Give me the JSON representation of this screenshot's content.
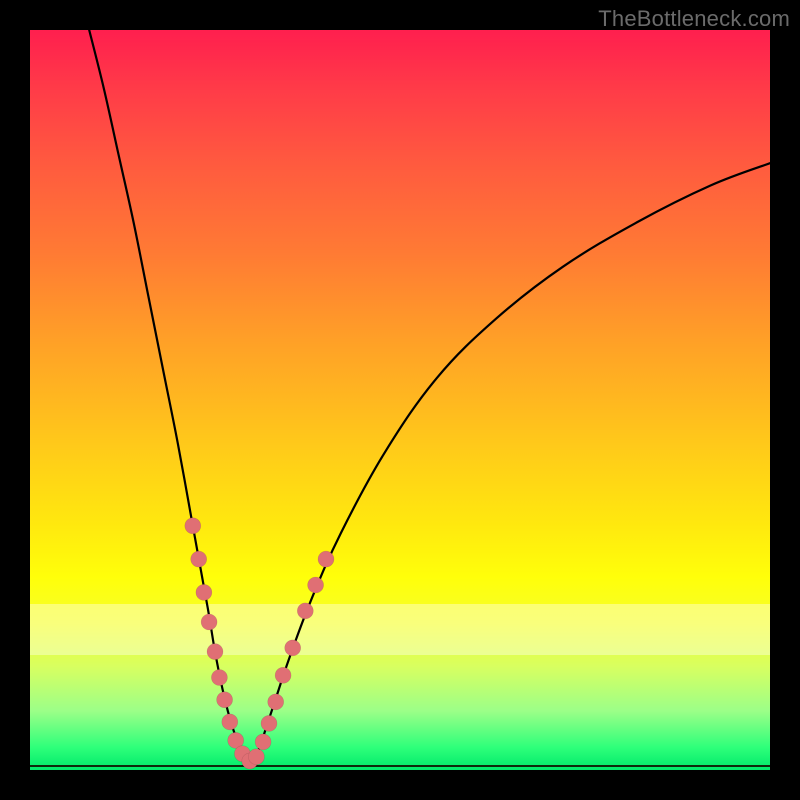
{
  "watermark": "TheBottleneck.com",
  "colors": {
    "marker": "#e06f74",
    "curve": "#000000",
    "flat_line": "#0f2a0c"
  },
  "chart_data": {
    "type": "line",
    "title": "",
    "xlabel": "",
    "ylabel": "",
    "xlim": [
      0,
      100
    ],
    "ylim": [
      0,
      100
    ],
    "series": [
      {
        "name": "left-branch",
        "x": [
          8,
          10,
          12,
          14,
          16,
          18,
          20,
          22,
          24,
          25,
          26,
          27,
          28,
          29,
          30
        ],
        "y": [
          100,
          92,
          83,
          74,
          64,
          54,
          44,
          33,
          22,
          16,
          11,
          7,
          4,
          2,
          1
        ]
      },
      {
        "name": "right-branch",
        "x": [
          30,
          31,
          32,
          33,
          35,
          38,
          42,
          48,
          55,
          63,
          72,
          82,
          92,
          100
        ],
        "y": [
          1,
          3,
          6,
          9,
          15,
          23,
          32,
          43,
          53,
          61,
          68,
          74,
          79,
          82
        ]
      },
      {
        "name": "floor",
        "x": [
          0,
          100
        ],
        "y": [
          0.5,
          0.5
        ]
      }
    ],
    "markers": {
      "name": "highlighted-points",
      "x": [
        22.0,
        22.8,
        23.5,
        24.2,
        25.0,
        25.6,
        26.3,
        27.0,
        27.8,
        28.7,
        29.7,
        30.6,
        31.5,
        32.3,
        33.2,
        34.2,
        35.5,
        37.2,
        38.6,
        40.0
      ],
      "y": [
        33.0,
        28.5,
        24.0,
        20.0,
        16.0,
        12.5,
        9.5,
        6.5,
        4.0,
        2.2,
        1.2,
        1.8,
        3.8,
        6.3,
        9.2,
        12.8,
        16.5,
        21.5,
        25.0,
        28.5
      ]
    },
    "legend": false,
    "grid": false
  }
}
